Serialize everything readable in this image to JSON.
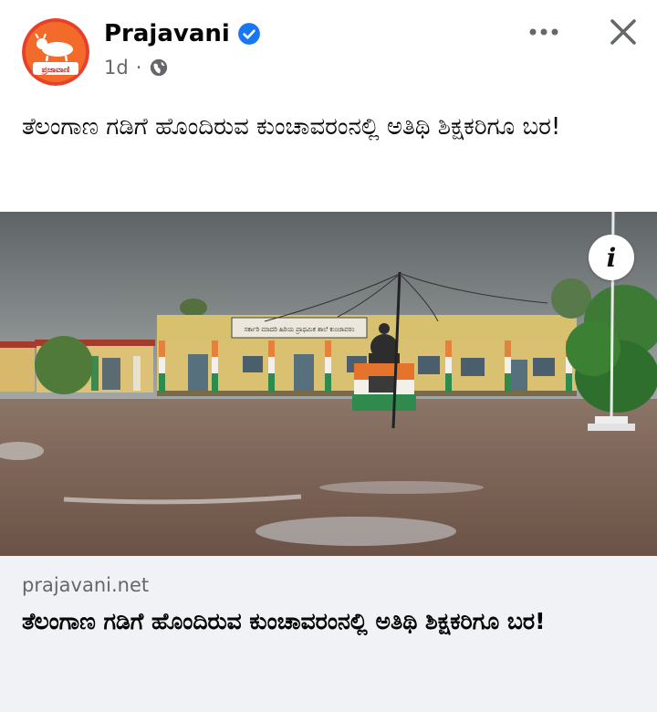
{
  "post": {
    "page_name": "Prajavani",
    "timestamp": "1d",
    "separator": "·",
    "privacy_icon": "globe-icon",
    "caption": "ತೆಲಂಗಾಣ ಗಡಿಗೆ ಹೊಂದಿರುವ ಕುಂಚಾವರಂನಲ್ಲಿ ಅತಿಥಿ ಶಿಕ್ಷಕರಿಗೂ ಬರ!"
  },
  "avatar": {
    "logo_text": "ಪ್ರಜಾವಾಣಿ"
  },
  "photo": {
    "info_label": "i",
    "sign_text": "ಸರ್ಕಾರಿ ಮಾದರಿ ಹಿರಿಯ ಪ್ರಾಥಮಿಕ ಶಾಲೆ ಕುಂಚಾವರಂ"
  },
  "link": {
    "domain": "prajavani.net",
    "title": "ತೆಲಂಗಾಣ ಗಡಿಗೆ ಹೊಂದಿರುವ ಕುಂಚಾವರಂನಲ್ಲಿ ಅತಿಥಿ ಶಿಕ್ಷಕರಿಗೂ ಬರ!"
  },
  "colors": {
    "verified": "#1877f2",
    "avatar_bg": "#e8402a",
    "secondary_text": "#65676b",
    "link_bg": "#f0f2f5"
  }
}
